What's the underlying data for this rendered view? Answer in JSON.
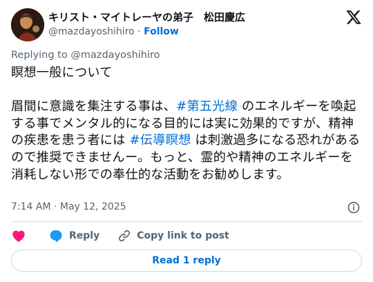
{
  "author": {
    "display_name": "キリスト・マイトレーヤの弟子　松田慶広",
    "handle": "@mazdayoshihiro",
    "separator": "·",
    "follow_label": "Follow"
  },
  "replying_to": "Replying to @mazdayoshihiro",
  "post": {
    "line1": "瞑想一般について",
    "para_a": "眉間に意識を集注する事は、",
    "hashtag1": "#第五光線",
    "para_b": " のエネルギーを喚起する事でメンタル的になる目的には実に効果的ですが、精神の疾患を患う者には ",
    "hashtag2": "#伝導瞑想",
    "para_c": " は刺激過多になる恐れがあるので推奨できませんー。もっと、霊的や精神のエネルギーを消耗しない形での奉仕的な活動をお勧めします。"
  },
  "timestamp": "7:14 AM · May 12, 2025",
  "actions": {
    "like_icon": "heart-icon",
    "reply_label": "Reply",
    "copy_link_label": "Copy link to post"
  },
  "read_reply_label": "Read 1 reply",
  "colors": {
    "link_blue": "#006fd6",
    "heart_red": "#f91880",
    "reply_blue": "#1d9bf0",
    "muted_text": "#536471",
    "border": "#cfd9de"
  }
}
